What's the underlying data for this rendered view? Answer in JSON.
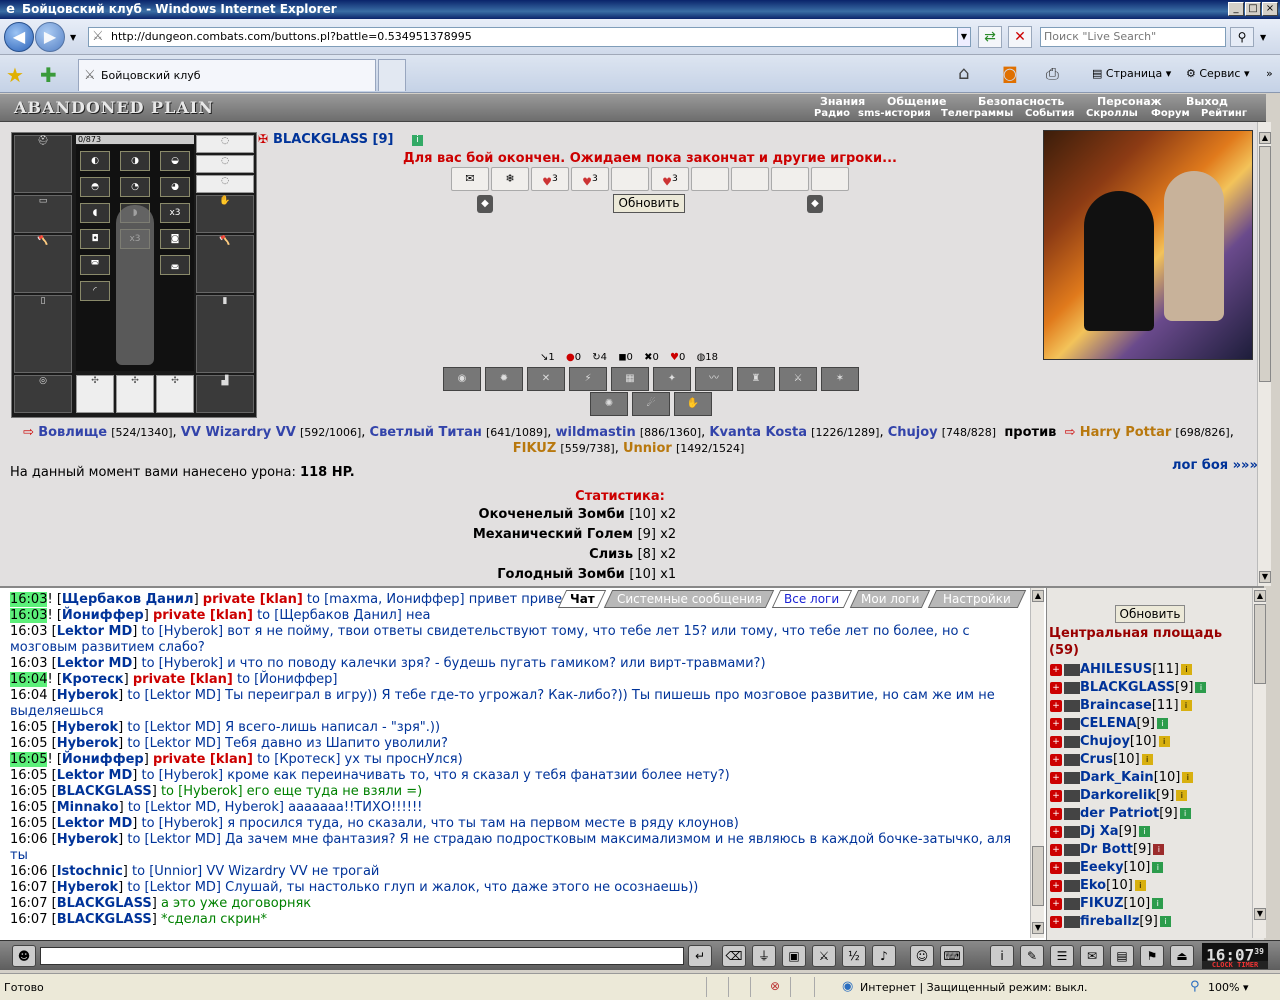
{
  "browser": {
    "window_title": "Бойцовский клуб - Windows Internet Explorer",
    "address": "http://dungeon.combats.com/buttons.pl?battle=0.534951378995",
    "search_placeholder": "Поиск \"Live Search\"",
    "tab_title": "Бойцовский клуб",
    "cmd_page": "Страница",
    "cmd_tools": "Сервис",
    "status": "Готово",
    "zone": "Интернет | Защищенный режим: выкл.",
    "zoom": "100%"
  },
  "game_header": {
    "logo": "ABANDONED PLAIN",
    "nav_top": [
      "Знания",
      "Общение",
      "Безопасность",
      "Персонаж",
      "Выход"
    ],
    "nav_bottom": [
      "Радио",
      "sms-история",
      "Телеграммы",
      "События",
      "Скроллы",
      "Форум",
      "Рейтинг"
    ]
  },
  "inventory": {
    "hp": "0/873",
    "counts": [
      "x3",
      "x3"
    ]
  },
  "battle": {
    "player_name": "BLACKGLASS [9]",
    "message": "Для вас бой окончен. Ожидаем пока закончат и другие игроки...",
    "refresh_label": "Обновить",
    "scroll_counts": [
      "3",
      "3",
      "3"
    ],
    "stats": [
      "1",
      "0",
      "4",
      "0",
      "0",
      "0",
      "18"
    ],
    "team1": [
      {
        "name": "Вовлище",
        "lv": "[524/1340]"
      },
      {
        "name": "VV Wizardry VV",
        "lv": "[592/1006]"
      },
      {
        "name": "Светлый Титан",
        "lv": "[641/1089]"
      },
      {
        "name": "wildmastin",
        "lv": "[886/1360]"
      },
      {
        "name": "Kvanta Kosta",
        "lv": "[1226/1289]"
      },
      {
        "name": "Chujoy",
        "lv": "[748/828]"
      }
    ],
    "vs": "против",
    "team2": [
      {
        "name": "Harry Pottar",
        "lv": "[698/826]"
      },
      {
        "name": "FIKUZ",
        "lv": "[559/738]"
      },
      {
        "name": "Unnior",
        "lv": "[1492/1524]"
      }
    ],
    "damage_prefix": "На данный момент вами нанесено урона:",
    "damage_value": "118 HP.",
    "log_link": "лог боя »»»",
    "stats_title": "Статистика:",
    "kills": [
      {
        "mob": "Окоченелый Зомби",
        "lv": "[10]",
        "count": "x2"
      },
      {
        "mob": "Механический Голем",
        "lv": "[9]",
        "count": "x2"
      },
      {
        "mob": "Слизь",
        "lv": "[8]",
        "count": "x2"
      },
      {
        "mob": "Голодный Зомби",
        "lv": "[10]",
        "count": "x1"
      }
    ]
  },
  "chat_tabs": [
    "Чат",
    "Системные сообщения",
    "Все логи",
    "Мои логи",
    "Настройки"
  ],
  "chat": [
    {
      "t": "16:03",
      "hl": true,
      "ex": "! [",
      "n": "Щербаков Данил",
      "ex2": "] ",
      "pv": "private [klan]",
      "msg": " to [maxma, Йониффер] привет приве"
    },
    {
      "t": "16:03",
      "hl": true,
      "ex": "! [",
      "n": "Йониффер",
      "ex2": "] ",
      "pv": "private [klan]",
      "msg": " to [Щербаков Данил] неа"
    },
    {
      "t": "16:03",
      "hl": false,
      "ex": " [",
      "n": "Lektor MD",
      "ex2": "] ",
      "pv": "",
      "to": "to [Hyberok]",
      "msg": " вот я не пойму, твои ответы свидетельствуют тому, что тебе лет 15? или тому, что тебе лет по более, но с мозговым развитием слабо?"
    },
    {
      "t": "16:03",
      "hl": false,
      "ex": " [",
      "n": "Lektor MD",
      "ex2": "] ",
      "pv": "",
      "to": "to [Hyberok]",
      "msg": " и что по поводу калечки зря? - будешь пугать гамиком? или вирт-травмами?)"
    },
    {
      "t": "16:04",
      "hl": true,
      "ex": "! [",
      "n": "Кротеск",
      "ex2": "] ",
      "pv": "private [klan]",
      "msg": " to [Йониффер]"
    },
    {
      "t": "16:04",
      "hl": false,
      "ex": " [",
      "n": "Hyberok",
      "ex2": "] ",
      "pv": "",
      "to": "to [Lektor MD]",
      "msg": " Ты переиграл в игру)) Я тебе где-то угрожал? Как-либо?)) Ты пишешь про мозговое развитие, но сам же им не выделяешься"
    },
    {
      "t": "16:05",
      "hl": false,
      "ex": " [",
      "n": "Hyberok",
      "ex2": "] ",
      "pv": "",
      "to": "to [Lektor MD]",
      "msg": " Я всего-лишь написал - \"зря\".))"
    },
    {
      "t": "16:05",
      "hl": false,
      "ex": " [",
      "n": "Hyberok",
      "ex2": "] ",
      "pv": "",
      "to": "to [Lektor MD]",
      "msg": " Тебя давно из Шапито уволили?"
    },
    {
      "t": "16:05",
      "hl": true,
      "ex": "! [",
      "n": "Йониффер",
      "ex2": "] ",
      "pv": "private [klan]",
      "msg": " to [Кротеск] ух ты проснУлся)"
    },
    {
      "t": "16:05",
      "hl": false,
      "ex": " [",
      "n": "Lektor MD",
      "ex2": "] ",
      "pv": "",
      "to": "to [Hyberok]",
      "msg": " кроме как переиначивать то, что я сказал у тебя фанатзии более нету?)"
    },
    {
      "t": "16:05",
      "hl": false,
      "ex": " [",
      "n": "BLACKGLASS",
      "ex2": "] ",
      "pv": "",
      "mine": "to [Hyberok] его еще туда не взяли =)"
    },
    {
      "t": "16:05",
      "hl": false,
      "ex": " [",
      "n": "Minnako",
      "ex2": "] ",
      "pv": "",
      "to": "to [Lektor MD, Hyberok]",
      "msg": " ааааааа!!ТИХО!!!!!!"
    },
    {
      "t": "16:05",
      "hl": false,
      "ex": " [",
      "n": "Lektor MD",
      "ex2": "] ",
      "pv": "",
      "to": "to [Hyberok]",
      "msg": " я просился туда, но сказали, что ты там на первом месте в ряду клоунов)"
    },
    {
      "t": "16:06",
      "hl": false,
      "ex": " [",
      "n": "Hyberok",
      "ex2": "] ",
      "pv": "",
      "to": "to [Lektor MD]",
      "msg": " Да зачем мне фантазия? Я не страдаю подростковым максимализмом и не являюсь в каждой бочке-затычко, аля ты"
    },
    {
      "t": "16:06",
      "hl": false,
      "ex": " [",
      "n": "Istochnic",
      "ex2": "] ",
      "pv": "",
      "to": "to [Unnior]",
      "msg": " VV Wizardry VV не трогай"
    },
    {
      "t": "16:07",
      "hl": false,
      "ex": " [",
      "n": "Hyberok",
      "ex2": "] ",
      "pv": "",
      "to": "to [Lektor MD]",
      "msg": " Слушай, ты настолько глуп и жалок, что даже этого не осознаешь))"
    },
    {
      "t": "16:07",
      "hl": false,
      "ex": " [",
      "n": "BLACKGLASS",
      "ex2": "] ",
      "pv": "",
      "mine": "а это уже договорняк"
    },
    {
      "t": "16:07",
      "hl": false,
      "ex": " [",
      "n": "BLACKGLASS",
      "ex2": "] ",
      "pv": "",
      "mine": "*сделал скрин*"
    }
  ],
  "online": {
    "refresh_label": "Обновить",
    "room": "Центральная площадь",
    "count": "(59)",
    "users": [
      {
        "name": "AHILESUS",
        "lv": "[11]",
        "info": "y"
      },
      {
        "name": "BLACKGLASS",
        "lv": "[9]",
        "info": "g"
      },
      {
        "name": "Braincase",
        "lv": "[11]",
        "info": "y"
      },
      {
        "name": "CELENA",
        "lv": "[9]",
        "info": "g"
      },
      {
        "name": "Chujoy",
        "lv": "[10]",
        "info": "y"
      },
      {
        "name": "Crus",
        "lv": "[10]",
        "info": "y"
      },
      {
        "name": "Dark_Kain",
        "lv": "[10]",
        "info": "y"
      },
      {
        "name": "Darkorelik",
        "lv": "[9]",
        "info": "y"
      },
      {
        "name": "der Patriot",
        "lv": "[9]",
        "info": "g"
      },
      {
        "name": "Dj Xa",
        "lv": "[9]",
        "info": "g"
      },
      {
        "name": "Dr Bott",
        "lv": "[9]",
        "info": "r"
      },
      {
        "name": "Eeeky",
        "lv": "[10]",
        "info": "g"
      },
      {
        "name": "Eko",
        "lv": "[10]",
        "info": "y"
      },
      {
        "name": "FIKUZ",
        "lv": "[10]",
        "info": "g"
      },
      {
        "name": "fireballz",
        "lv": "[9]",
        "info": "g"
      }
    ]
  },
  "clock": {
    "time": "16:07",
    "sec": "39",
    "label": "CLOCK TIMER"
  }
}
